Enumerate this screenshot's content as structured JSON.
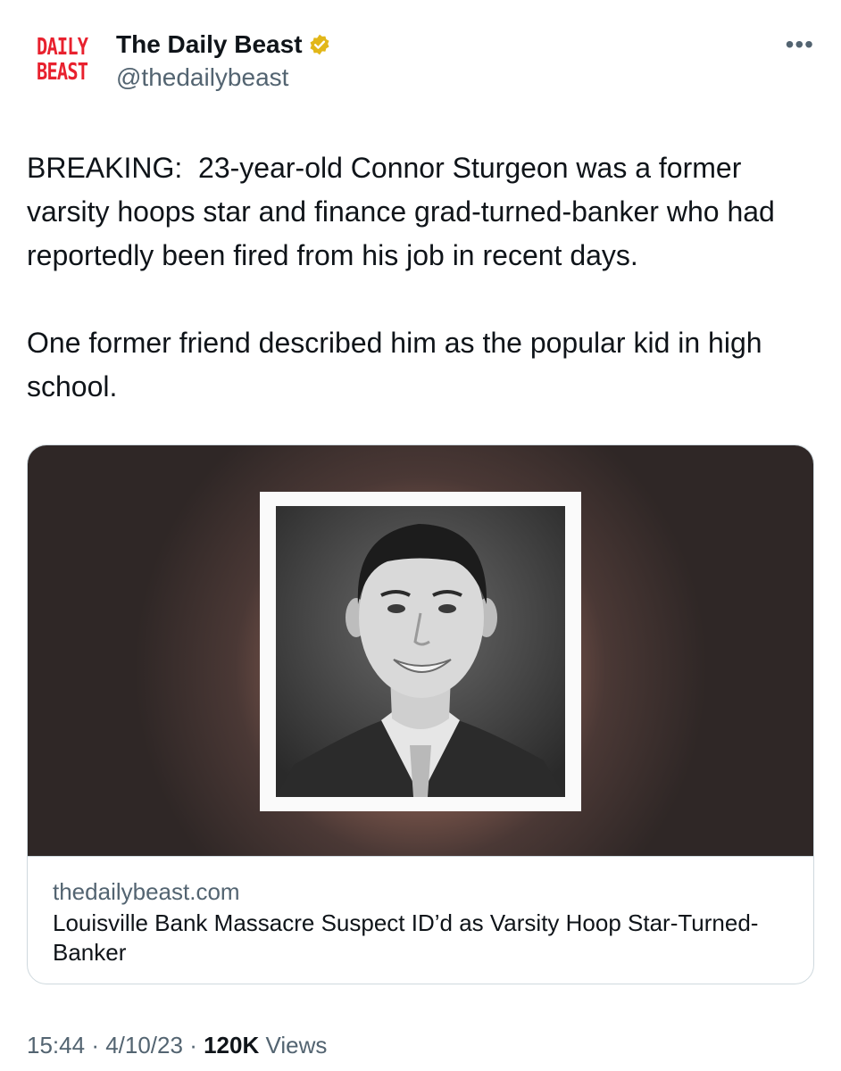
{
  "author": {
    "logo_line1": "DAILY",
    "logo_line2": "BEAST",
    "display_name": "The Daily Beast",
    "handle": "@thedailybeast",
    "verified_icon": "gold-verified-badge"
  },
  "more_label": "•••",
  "tweet": {
    "paragraph1": "BREAKING:  23-year-old Connor Sturgeon was a former varsity hoops star and finance grad-turned-banker who had reportedly been fired from his job in recent days.",
    "paragraph2": "One former friend described him as the popular kid in high school."
  },
  "card": {
    "domain": "thedailybeast.com",
    "title": "Louisville Bank Massacre Suspect ID’d as Varsity Hoop Star-Turned-Banker"
  },
  "meta": {
    "time": "15:44",
    "date": "4/10/23",
    "views_count": "120K",
    "views_label": "Views"
  },
  "colors": {
    "logo_red": "#e8212e",
    "secondary_text": "#536471",
    "verified_gold": "#e2b719"
  }
}
